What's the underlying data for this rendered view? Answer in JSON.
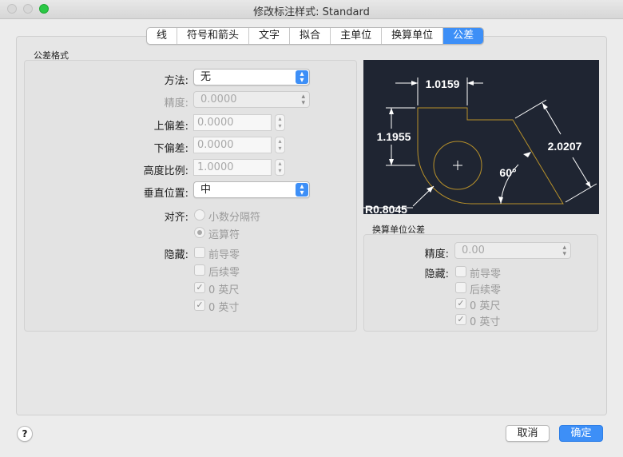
{
  "window": {
    "title": "修改标注样式: Standard"
  },
  "tabs": [
    {
      "label": "线"
    },
    {
      "label": "符号和箭头"
    },
    {
      "label": "文字"
    },
    {
      "label": "拟合"
    },
    {
      "label": "主单位"
    },
    {
      "label": "换算单位"
    },
    {
      "label": "公差",
      "active": true
    }
  ],
  "tolerance_format": {
    "group_label": "公差格式",
    "method": {
      "label": "方法:",
      "value": "无"
    },
    "precision": {
      "label": "精度:",
      "value": "0.0000"
    },
    "upper": {
      "label": "上偏差:",
      "value": "0.0000"
    },
    "lower": {
      "label": "下偏差:",
      "value": "0.0000"
    },
    "height_scale": {
      "label": "高度比例:",
      "value": "1.0000"
    },
    "vertical_position": {
      "label": "垂直位置:",
      "value": "中"
    },
    "alignment": {
      "label": "对齐:",
      "option1": "小数分隔符",
      "option2": "运算符",
      "selected": 2
    },
    "suppress": {
      "label": "隐藏:",
      "leading": "前导零",
      "trailing": "后续零",
      "feet": "0 英尺",
      "inches": "0 英寸"
    }
  },
  "preview": {
    "dims": {
      "top": "1.0159",
      "left": "1.1955",
      "right": "2.0207",
      "angle": "60°",
      "radius": "R0.8045"
    },
    "colors": {
      "background": "#1f2532",
      "geometry": "#b8912a",
      "dimension": "#ffffff"
    }
  },
  "alt_tolerance": {
    "group_label": "换算单位公差",
    "precision": {
      "label": "精度:",
      "value": "0.00"
    },
    "suppress": {
      "label": "隐藏:",
      "leading": "前导零",
      "trailing": "后续零",
      "feet": "0 英尺",
      "inches": "0 英寸"
    }
  },
  "buttons": {
    "help": "?",
    "cancel": "取消",
    "ok": "确定"
  },
  "colors": {
    "accent": "#3d8ff7"
  }
}
